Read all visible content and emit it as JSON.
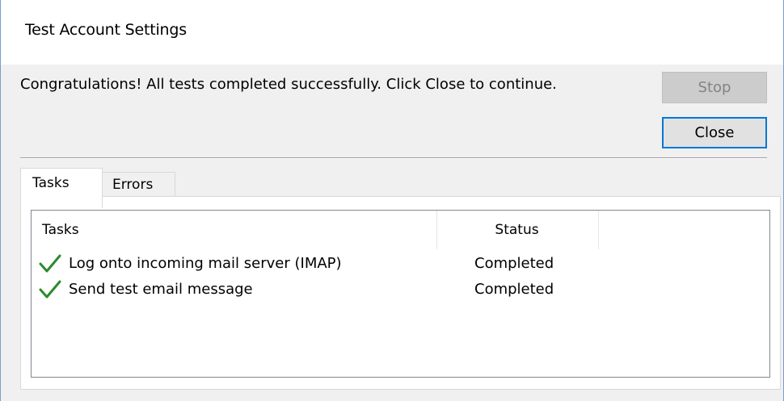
{
  "dialog": {
    "title": "Test Account Settings",
    "message": "Congratulations! All tests completed successfully. Click Close to continue.",
    "buttons": {
      "stop_label": "Stop",
      "close_label": "Close"
    },
    "tabs": [
      {
        "label": "Tasks",
        "selected": true
      },
      {
        "label": "Errors",
        "selected": false
      }
    ],
    "task_list": {
      "columns": [
        "Tasks",
        "Status"
      ],
      "rows": [
        {
          "icon": "checkmark-icon",
          "task": "Log onto incoming mail server (IMAP)",
          "status": "Completed"
        },
        {
          "icon": "checkmark-icon",
          "task": "Send test email message",
          "status": "Completed"
        }
      ]
    }
  },
  "colors": {
    "accent": "#0078d7",
    "check_green": "#2c8a2c",
    "disabled_text": "#838383"
  }
}
